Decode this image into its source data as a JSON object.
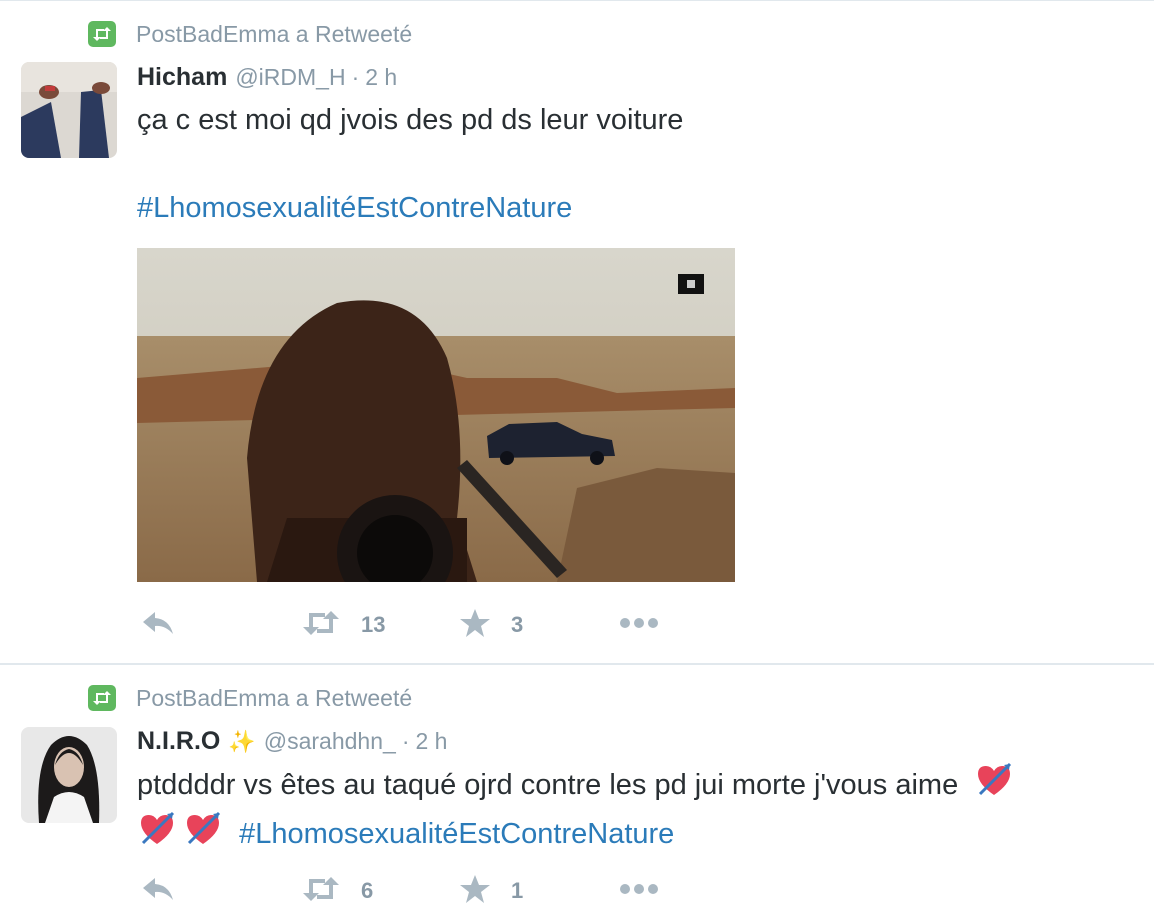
{
  "tweets": [
    {
      "retweet_context": "PostBadEmma a Retweeté",
      "fullname": "Hicham",
      "handle": "@iRDM_H",
      "separator": "·",
      "time": "2 h",
      "text_line1": "ça c est moi qd jvois des pd ds leur voiture",
      "hashtag": "#LhomosexualitéEstContreNature",
      "retweets": "13",
      "favorites": "3"
    },
    {
      "retweet_context": "PostBadEmma a Retweeté",
      "fullname": "N.I.R.O",
      "handle": "@sarahdhn_",
      "separator": "·",
      "time": "2 h",
      "text_line1": "ptddddr vs êtes au taqué ojrd contre les pd jui morte j'vous aime",
      "hashtag": "#LhomosexualitéEstContreNature",
      "retweets": "6",
      "favorites": "1"
    }
  ],
  "colors": {
    "retweet_green": "#5fb85f",
    "hashtag_blue": "#2b7bb9",
    "muted_gray": "#8899a6",
    "icon_gray": "#aab8c2"
  },
  "icons": [
    "retweet-icon",
    "reply-icon",
    "star-icon",
    "more-icon",
    "sparkles-icon",
    "heart-arrow-icon"
  ]
}
